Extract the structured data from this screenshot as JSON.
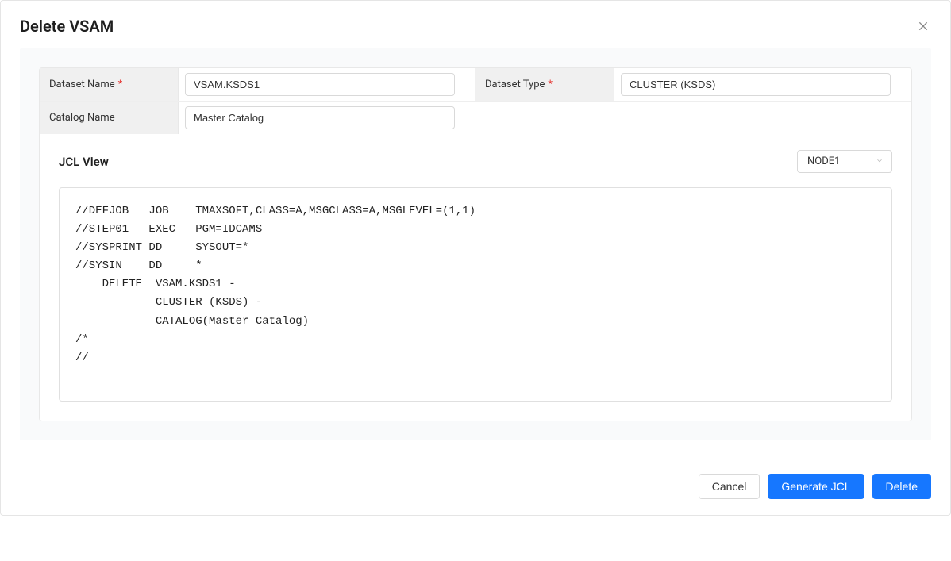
{
  "modal": {
    "title": "Delete VSAM"
  },
  "form": {
    "dataset_name": {
      "label": "Dataset Name",
      "value": "VSAM.KSDS1",
      "required": true
    },
    "dataset_type": {
      "label": "Dataset Type",
      "value": "CLUSTER (KSDS)",
      "required": true
    },
    "catalog_name": {
      "label": "Catalog Name",
      "value": "Master Catalog",
      "required": false
    }
  },
  "jcl": {
    "title": "JCL View",
    "node": "NODE1",
    "code": "//DEFJOB   JOB    TMAXSOFT,CLASS=A,MSGCLASS=A,MSGLEVEL=(1,1)\n//STEP01   EXEC   PGM=IDCAMS\n//SYSPRINT DD     SYSOUT=*\n//SYSIN    DD     *\n    DELETE  VSAM.KSDS1 -\n            CLUSTER (KSDS) -\n            CATALOG(Master Catalog)\n/*\n//"
  },
  "footer": {
    "cancel": "Cancel",
    "generate": "Generate JCL",
    "delete": "Delete"
  }
}
